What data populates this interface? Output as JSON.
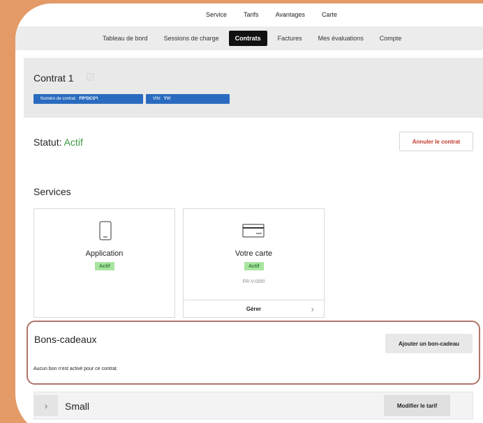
{
  "top_nav": [
    "Service",
    "Tarifs",
    "Avantages",
    "Carte"
  ],
  "sub_nav": {
    "items": [
      "Tableau de bord",
      "Sessions de charge",
      "Contrats",
      "Factures",
      "Mes évaluations",
      "Compte"
    ],
    "active": "Contrats"
  },
  "contract": {
    "title": "Contrat 1",
    "edit_icon": "edit-icon",
    "number_label": "Numéro de contrat:",
    "number_value": "FR*DCS*\\",
    "vin_label": "VIN:",
    "vin_value": "YV!",
    "chip_color": "#2a6bbf"
  },
  "status": {
    "label": "Statut:",
    "value": "Actif",
    "value_color": "#3a9a3f",
    "cancel_label": "Annuler le contrat",
    "cancel_color": "#c0392b"
  },
  "services": {
    "title": "Services",
    "cards": [
      {
        "name": "Application",
        "badge": "Actif",
        "icon": "phone-icon"
      },
      {
        "name": "Votre carte",
        "badge": "Actif",
        "icon": "card-icon",
        "code": "FR-V-000!",
        "manage_label": "Gérer"
      }
    ]
  },
  "vouchers": {
    "title": "Bons-cadeaux",
    "add_label": "Ajouter un bon-cadeau",
    "empty_text": "Aucun bon n'est activé pour ce contrat."
  },
  "tariff": {
    "name": "Small",
    "modify_label": "Modifier le tarif"
  }
}
